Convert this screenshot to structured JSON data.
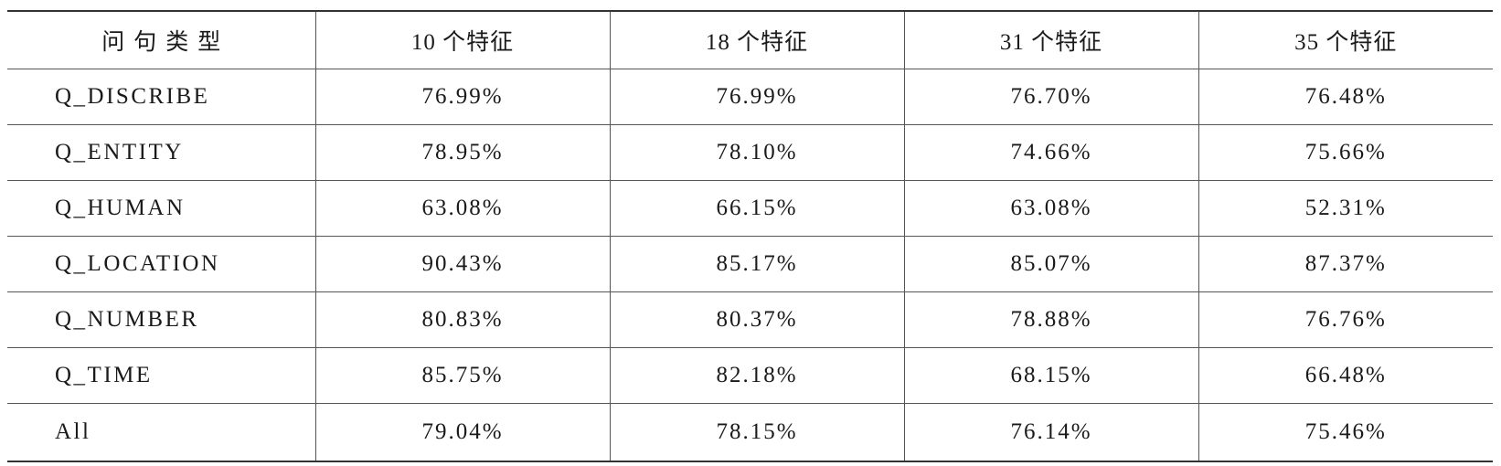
{
  "table": {
    "headers": [
      "问句类型",
      "10 个特征",
      "18 个特征",
      "31 个特征",
      "35 个特征"
    ],
    "rows": [
      {
        "label": "Q_DISCRIBE",
        "values": [
          "76.99%",
          "76.99%",
          "76.70%",
          "76.48%"
        ]
      },
      {
        "label": "Q_ENTITY",
        "values": [
          "78.95%",
          "78.10%",
          "74.66%",
          "75.66%"
        ]
      },
      {
        "label": "Q_HUMAN",
        "values": [
          "63.08%",
          "66.15%",
          "63.08%",
          "52.31%"
        ]
      },
      {
        "label": "Q_LOCATION",
        "values": [
          "90.43%",
          "85.17%",
          "85.07%",
          "87.37%"
        ]
      },
      {
        "label": "Q_NUMBER",
        "values": [
          "80.83%",
          "80.37%",
          "78.88%",
          "76.76%"
        ]
      },
      {
        "label": "Q_TIME",
        "values": [
          "85.75%",
          "82.18%",
          "68.15%",
          "66.48%"
        ]
      },
      {
        "label": "All",
        "values": [
          "79.04%",
          "78.15%",
          "76.14%",
          "75.46%"
        ]
      }
    ]
  }
}
